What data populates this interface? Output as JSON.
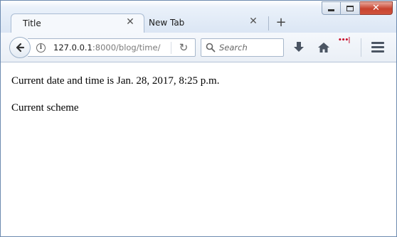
{
  "tabs": [
    {
      "label": "Title",
      "active": true
    },
    {
      "label": "New Tab",
      "active": false
    }
  ],
  "new_tab_symbol": "+",
  "toolbar": {
    "url_host": "127.0.0.1",
    "url_rest": ":8000/blog/time/",
    "search_placeholder": "Search",
    "pocket_label": "•••|"
  },
  "content": {
    "datetime_line": "Current date and time is Jan. 28, 2017, 8:25 p.m.",
    "scheme_line": "Current scheme"
  },
  "colors": {
    "close_button": "#c8432f",
    "chrome_blue": "#dbe6f4"
  }
}
